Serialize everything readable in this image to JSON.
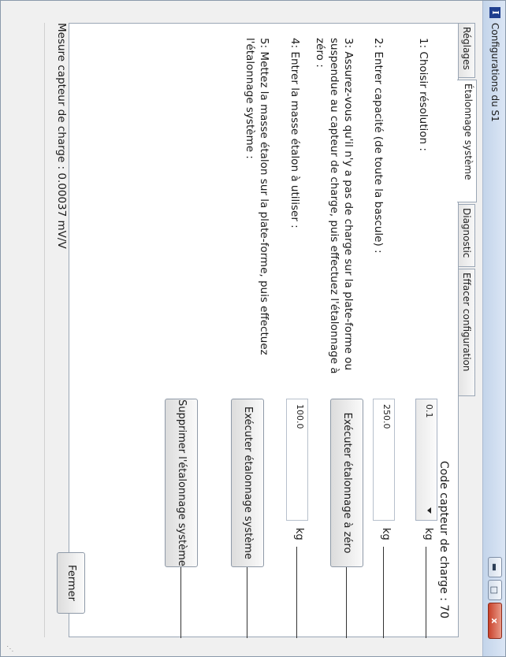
{
  "window": {
    "title": "Configurations du S1",
    "icon_letter": "I",
    "controls": [
      "minimize-icon",
      "maximize-icon",
      "close-icon"
    ],
    "close_glyph": "x"
  },
  "tabs": [
    {
      "label": "Réglages",
      "active": false
    },
    {
      "label": "Étalonnage système",
      "active": true
    },
    {
      "label": "Diagnostic",
      "active": false
    },
    {
      "label": "Effacer configuration",
      "active": false
    }
  ],
  "load_code": "Code capteur de charge : 70",
  "steps": [
    {
      "text": "1: Choisir résolution :"
    },
    {
      "text": "2: Entrer capacité (de toute la bascule) :"
    },
    {
      "text": "3: Assurez-vous qu'il n'y a pas de charge sur la plate-forme ou suspendue au capteur de charge, puis effectuez l'étalonnage à zéro :"
    },
    {
      "text": "4: Entrer la masse étalon à utiliser :"
    },
    {
      "text": "5: Mettez la masse étalon sur la plate-forme, puis effectuez l'étalonnage système :"
    }
  ],
  "controls": {
    "resolution_value": "0.1",
    "capacity_value": "250.0",
    "mass_value": "100.0",
    "unit": "kg",
    "zero_button": "Exécuter étalonnage à zéro",
    "calibrate_button": "Exécuter étalonnage système",
    "delete_button": "Supprimer l'étalonnage système"
  },
  "measurement": "Mesure capteur de charge : 0.00037 mV/V",
  "close_button": "Fermer"
}
